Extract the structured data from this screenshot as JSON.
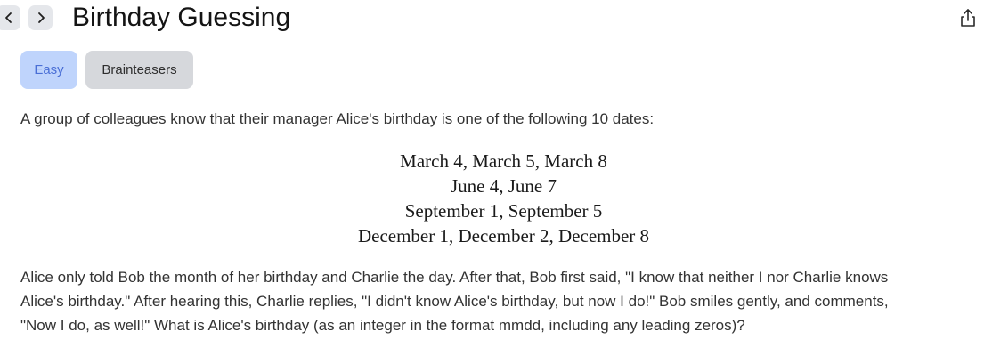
{
  "header": {
    "title": "Birthday Guessing"
  },
  "tags": {
    "difficulty": "Easy",
    "category": "Brainteasers"
  },
  "problem": {
    "intro": "A group of colleagues know that their manager Alice's birthday is one of the following 10 dates:",
    "dates": [
      "March 4, March 5, March 8",
      "June 4, June 7",
      "September 1, September 5",
      "December 1, December 2, December 8"
    ],
    "body_lines": [
      "Alice only told Bob the month of her birthday and Charlie the day. After that, Bob first said, \"I know that neither I nor Charlie knows",
      "Alice's birthday.\" After hearing this, Charlie replies, \"I didn't know Alice's birthday, but now I do!\" Bob smiles gently, and comments,",
      "\"Now I do, as well!\" What is Alice's birthday (as an integer in the format mmdd, including any leading zeros)?"
    ]
  },
  "icons": {
    "prev": "chevron-left-icon",
    "next": "chevron-right-icon",
    "share": "share-icon"
  },
  "colors": {
    "easy_tag_bg": "#bfd4fc",
    "easy_tag_text": "#4a6fd6",
    "category_tag_bg": "#d6d8dc",
    "nav_button_bg": "#e5e7eb"
  }
}
